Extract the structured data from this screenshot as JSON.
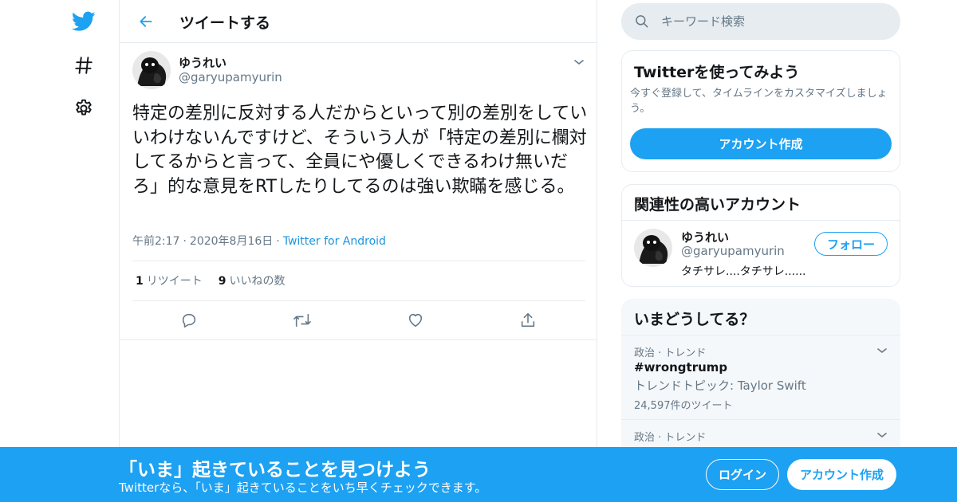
{
  "colors": {
    "brand": "#1da1f2",
    "text_primary": "#14171a",
    "text_secondary": "#657786",
    "border": "#e6ecf0"
  },
  "nav": {
    "items": [
      {
        "icon": "twitter-bird-icon"
      },
      {
        "icon": "hashtag-icon"
      },
      {
        "icon": "gear-icon"
      }
    ]
  },
  "header": {
    "back_icon": "arrow-left-icon",
    "title": "ツイートする"
  },
  "tweet": {
    "author_name": "ゆうれい",
    "author_handle": "@garyupamyurin",
    "text": "特定の差別に反対する人だからといって別の差別をしていいわけないんですけど、そういう人が「特定の差別に欄対してるからと言って、全員にや優しくできるわけ無いだろ」的な意見をRTしたりしてるのは強い欺瞞を感じる。",
    "time": "午前2:17",
    "date": "2020年8月16日",
    "source": "Twitter for Android",
    "retweet_count": "1",
    "retweet_label": "リツイート",
    "like_count": "9",
    "like_label": "いいねの数",
    "actions": [
      "reply-icon",
      "retweet-icon",
      "like-icon",
      "share-icon"
    ]
  },
  "search": {
    "placeholder": "キーワード検索"
  },
  "signup_card": {
    "title": "Twitterを使ってみよう",
    "description": "今すぐ登録して、タイムラインをカスタマイズしましょう。",
    "button_label": "アカウント作成"
  },
  "related_card": {
    "title": "関連性の高いアカウント",
    "account": {
      "name": "ゆうれい",
      "handle": "@garyupamyurin",
      "bio": "タチサレ....タチサレ......",
      "follow_label": "フォロー"
    }
  },
  "trends": {
    "title": "いまどうしてる？",
    "items": [
      {
        "meta": "政治 · トレンド",
        "name": "#wrongtrump",
        "topic": "トレンドトピック: Taylor Swift",
        "count": "24,597件のツイート"
      },
      {
        "meta": "政治 · トレンド"
      }
    ]
  },
  "banner": {
    "title": "「いま」起きていることを見つけよう",
    "subtitle": "Twitterなら、「いま」起きていることをいち早くチェックできます。",
    "login_label": "ログイン",
    "signup_label": "アカウント作成"
  }
}
